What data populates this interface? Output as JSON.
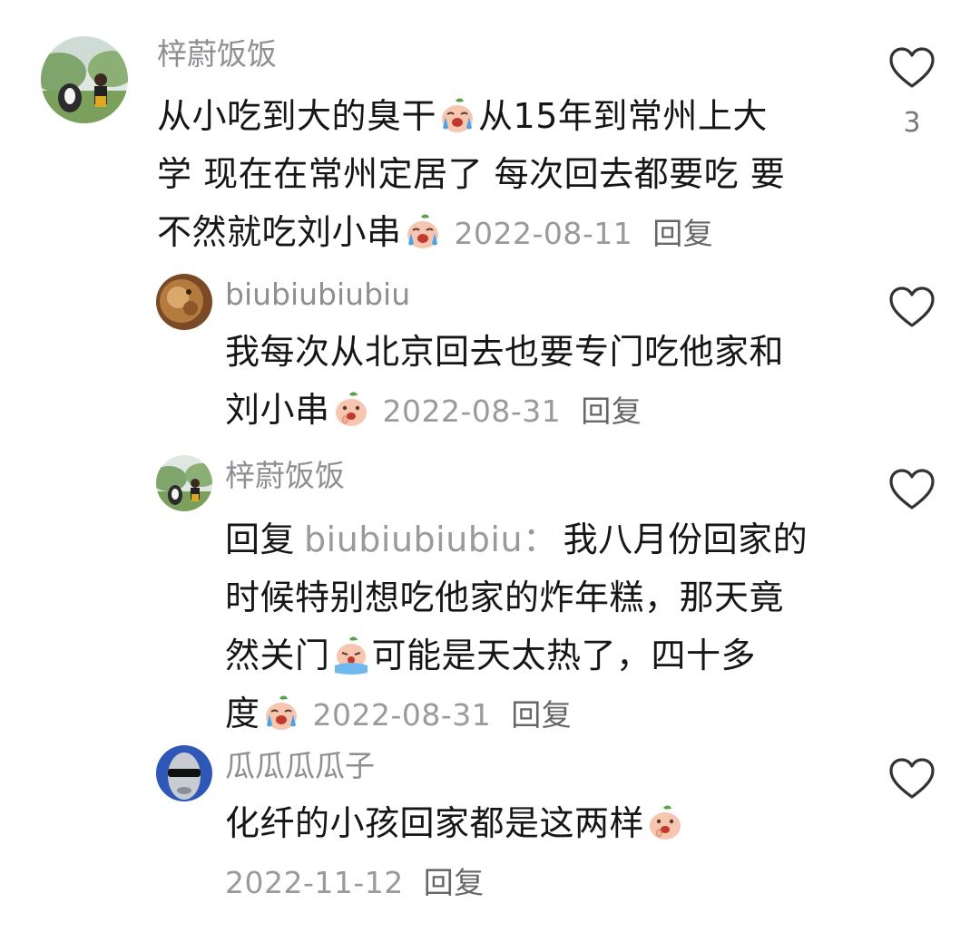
{
  "comments": [
    {
      "username": "梓蔚饭饭",
      "lines": [
        "从小吃到大的臭干",
        "从15年到常州上大",
        "学 现在在常州定居了 每次回去都要吃 要",
        "不然就吃刘小串"
      ],
      "emojis": [
        "crying-peach-emoji",
        "crying-peach-emoji"
      ],
      "date": "2022-08-11",
      "reply_label": "回复",
      "like_count": "3"
    },
    {
      "username": "biubiubiubiu",
      "lines": [
        "我每次从北京回去也要专门吃他家和",
        "刘小串"
      ],
      "emojis": [
        "laughing-peach-emoji"
      ],
      "date": "2022-08-31",
      "reply_label": "回复"
    },
    {
      "username": "梓蔚饭饭",
      "reply_prefix": "回复",
      "reply_to": "biubiubiubiu：",
      "lines": [
        "我八月份回家的",
        "时候特别想吃他家的炸年糕，那天竟",
        "然关门",
        "可能是天太热了，四十多",
        "度"
      ],
      "emojis": [
        "sobbing-peach-emoji",
        "crying-peach-emoji"
      ],
      "date": "2022-08-31",
      "reply_label": "回复"
    },
    {
      "username": "瓜瓜瓜瓜子",
      "lines": [
        "化纤的小孩回家都是这两样"
      ],
      "emojis": [
        "laughing-peach-emoji"
      ],
      "date": "2022-11-12",
      "reply_label": "回复"
    }
  ],
  "icons": {
    "like": "heart-outline-icon"
  },
  "colors": {
    "username": "#8e8e93",
    "text": "#161616",
    "meta": "#9a9a9a",
    "heart": "#333333"
  }
}
